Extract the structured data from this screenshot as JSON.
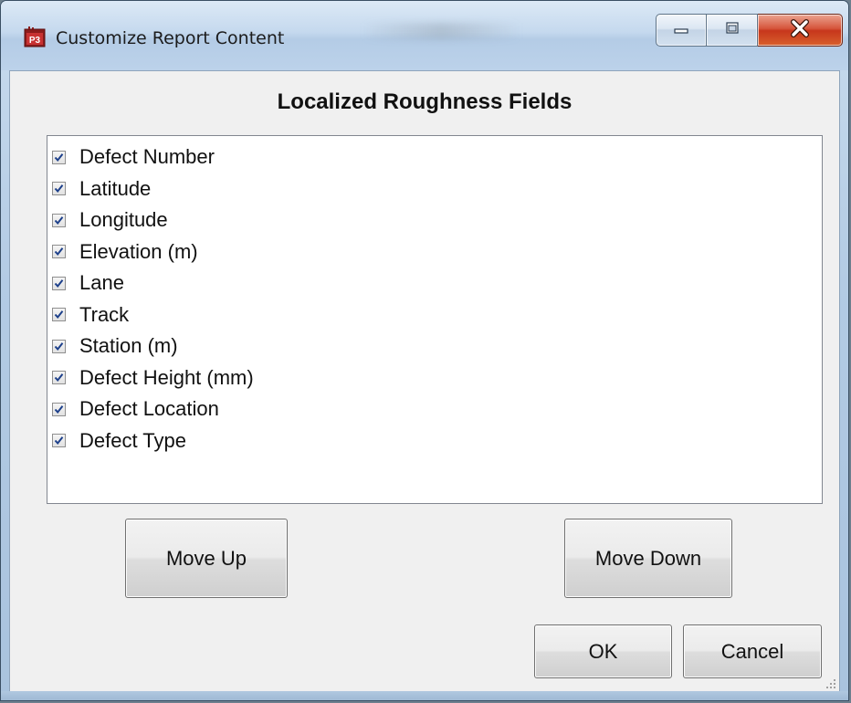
{
  "window": {
    "title": "Customize Report Content",
    "app_icon": "p3-app-icon",
    "controls": {
      "minimize_icon": "minimize-icon",
      "maximize_icon": "maximize-icon",
      "close_icon": "close-icon"
    }
  },
  "dialog": {
    "heading": "Localized Roughness Fields",
    "fields": [
      {
        "label": "Defect Number",
        "checked": true
      },
      {
        "label": "Latitude",
        "checked": true
      },
      {
        "label": "Longitude",
        "checked": true
      },
      {
        "label": "Elevation (m)",
        "checked": true
      },
      {
        "label": "Lane",
        "checked": true
      },
      {
        "label": "Track",
        "checked": true
      },
      {
        "label": "Station (m)",
        "checked": true
      },
      {
        "label": "Defect Height (mm)",
        "checked": true
      },
      {
        "label": "Defect Location",
        "checked": true
      },
      {
        "label": "Defect Type",
        "checked": true
      }
    ],
    "buttons": {
      "move_up": "Move Up",
      "move_down": "Move Down",
      "ok": "OK",
      "cancel": "Cancel"
    }
  },
  "colors": {
    "close_button": "#c7361c",
    "client_background": "#f0f0f0",
    "checkmark": "#1c3f8a"
  }
}
